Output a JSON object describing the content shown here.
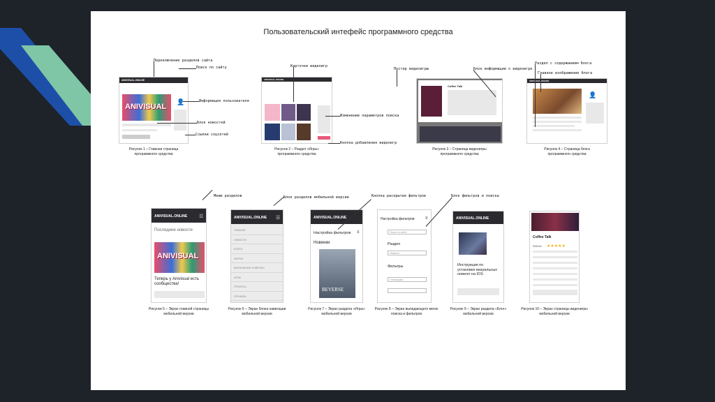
{
  "slide_title": "Пользовательский интефейс программного средства",
  "brand": "ANIVISUAL.ONLINE",
  "brand_big": "ANIVISUAL",
  "annotations": {
    "site_sections": "Переключение разделов сайта",
    "site_search": "Поиск по сайту",
    "user_info": "Информация пользователя",
    "news_block": "Блок новостей",
    "social_links": "Ссылки соцсетей",
    "game_cards": "Карточки видеоигр",
    "search_params": "Изменение параметров поиска",
    "add_game_button": "Кнопка добавления видеоигр",
    "game_poster": "Постер видеоигры",
    "game_info_block": "Блок информации о видеоигре",
    "blog_content": "Раздел с содержанием блога",
    "blog_main_image": "Главное изображение блога",
    "sections_menu": "Меню разделов",
    "mobile_sections_block": "Блок разделов мобильной версии",
    "filters_open_button": "Кнопка раскрытия фильтров",
    "filter_search_block": "Блок фильтров и поиска"
  },
  "captions": {
    "fig1": [
      "Рисунок 1 – Главная страница",
      "программного средства"
    ],
    "fig2": [
      "Рисунок 2 – Раздел «Игры»",
      "программного средства"
    ],
    "fig3": [
      "Рисунок 3 – Страница видеоигры",
      "программного средства"
    ],
    "fig4": [
      "Рисунок 4 – Страница блога",
      "программного средства"
    ],
    "fig5": [
      "Рисунок 5 – Экран главной страницы",
      "мобильной версии"
    ],
    "fig6": [
      "Рисунок 6 – Экран блока навигации",
      "мобильной версии"
    ],
    "fig7": [
      "Рисунок 7 – Экран раздела «Игры»",
      "мобильной версии"
    ],
    "fig8": [
      "Рисунок 8 – Экран выпадающего меню",
      "поиска и фильтров"
    ],
    "fig9": [
      "Рисунок 9 – Экран раздела «Блог»",
      "мобильной версии"
    ],
    "fig10": [
      "Рисунок 10 – Экран страницы видеоигры",
      "мобильной версии"
    ]
  },
  "mobile": {
    "latest_news": "Последние новости",
    "news_headline": "Теперь у Anivisual есть сообщества!",
    "nav_items": [
      "ГЛАВНАЯ",
      "НОВОСТИ",
      "БЛОГИ",
      "ФОРУМ",
      "ВИЗУАЛЬНЫЕ НОВЕЛЛЫ",
      "ИГРЫ",
      "ПРОЕКТЫ",
      "ПРОФИЛЬ"
    ],
    "filter_settings": "Настройка фильтров",
    "new_games": "Новинки",
    "game_title_cover": "BEVERSE",
    "search_placeholder": "Поиск по сайту",
    "section_label": "Раздел",
    "section_value": "Новинки",
    "filters_label": "Фильтры",
    "filter_value": "Платформа",
    "blog_headline": "Инструкция по установке визуальных новелл на IOS",
    "coffee_talk": "Coffee Talk",
    "coffee_talk_small": "Coffee Talk",
    "rating_label": "Рейтинг",
    "rating_stars": "★★★★★"
  },
  "colors": {
    "background": "#1e2229",
    "stripe_blue": "#1d4fa8",
    "stripe_green": "#7ec6a6",
    "bar": "#2b2b2f",
    "accent": "#e65a7a"
  }
}
